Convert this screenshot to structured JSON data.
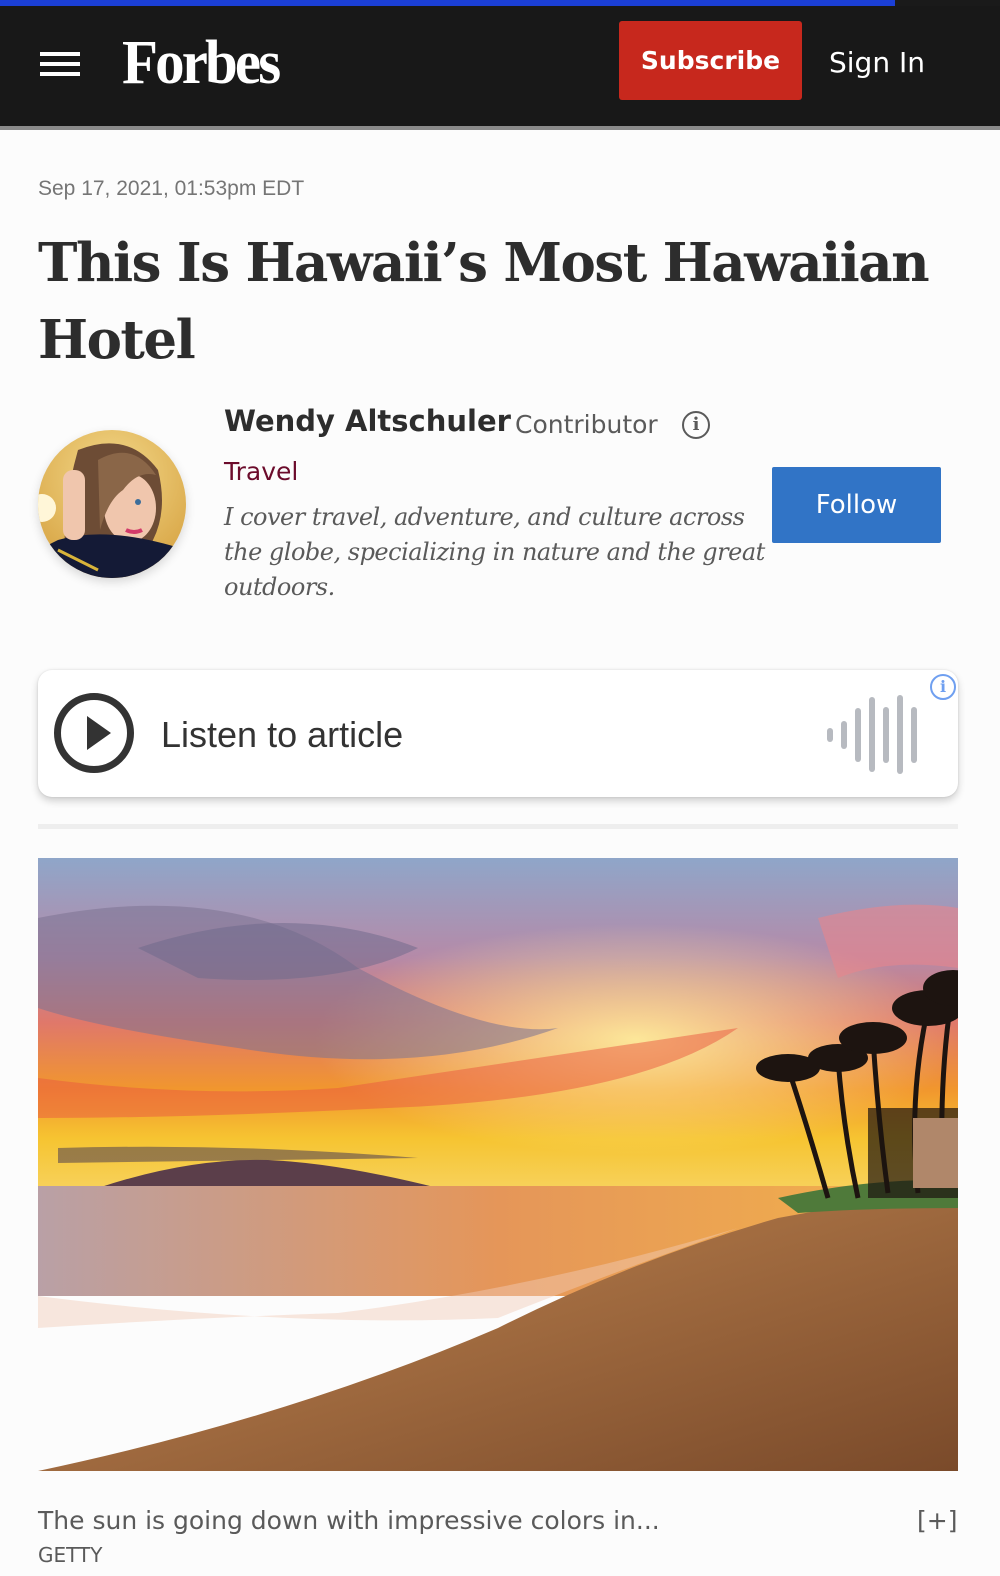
{
  "reading_progress": 0.895,
  "header": {
    "logo": "Forbes",
    "subscribe_label": "Subscribe",
    "signin_label": "Sign In"
  },
  "article": {
    "date": "Sep 17, 2021, 01:53pm EDT",
    "title": "This Is Hawaii’s Most Hawaiian Hotel"
  },
  "author": {
    "name": "Wendy Altschuler",
    "role": "Contributor",
    "info_icon": "ⓘ",
    "channel": "Travel",
    "bio": "I cover travel, adventure, and culture across the globe, specializing in nature and the great outdoors.",
    "follow_label": "Follow"
  },
  "listen": {
    "label": "Listen to article",
    "info_icon": "i"
  },
  "hero_image": {
    "alt": "Sunset over a Hawaiian beach with palm trees",
    "caption": "The sun is going down with impressive colors in...",
    "expand_label": "[+]",
    "credit": "GETTY"
  },
  "colors": {
    "progress": "#1b3fd6",
    "subscribe": "#c7281d",
    "follow": "#3174c6",
    "channel": "#6b0b2b"
  }
}
